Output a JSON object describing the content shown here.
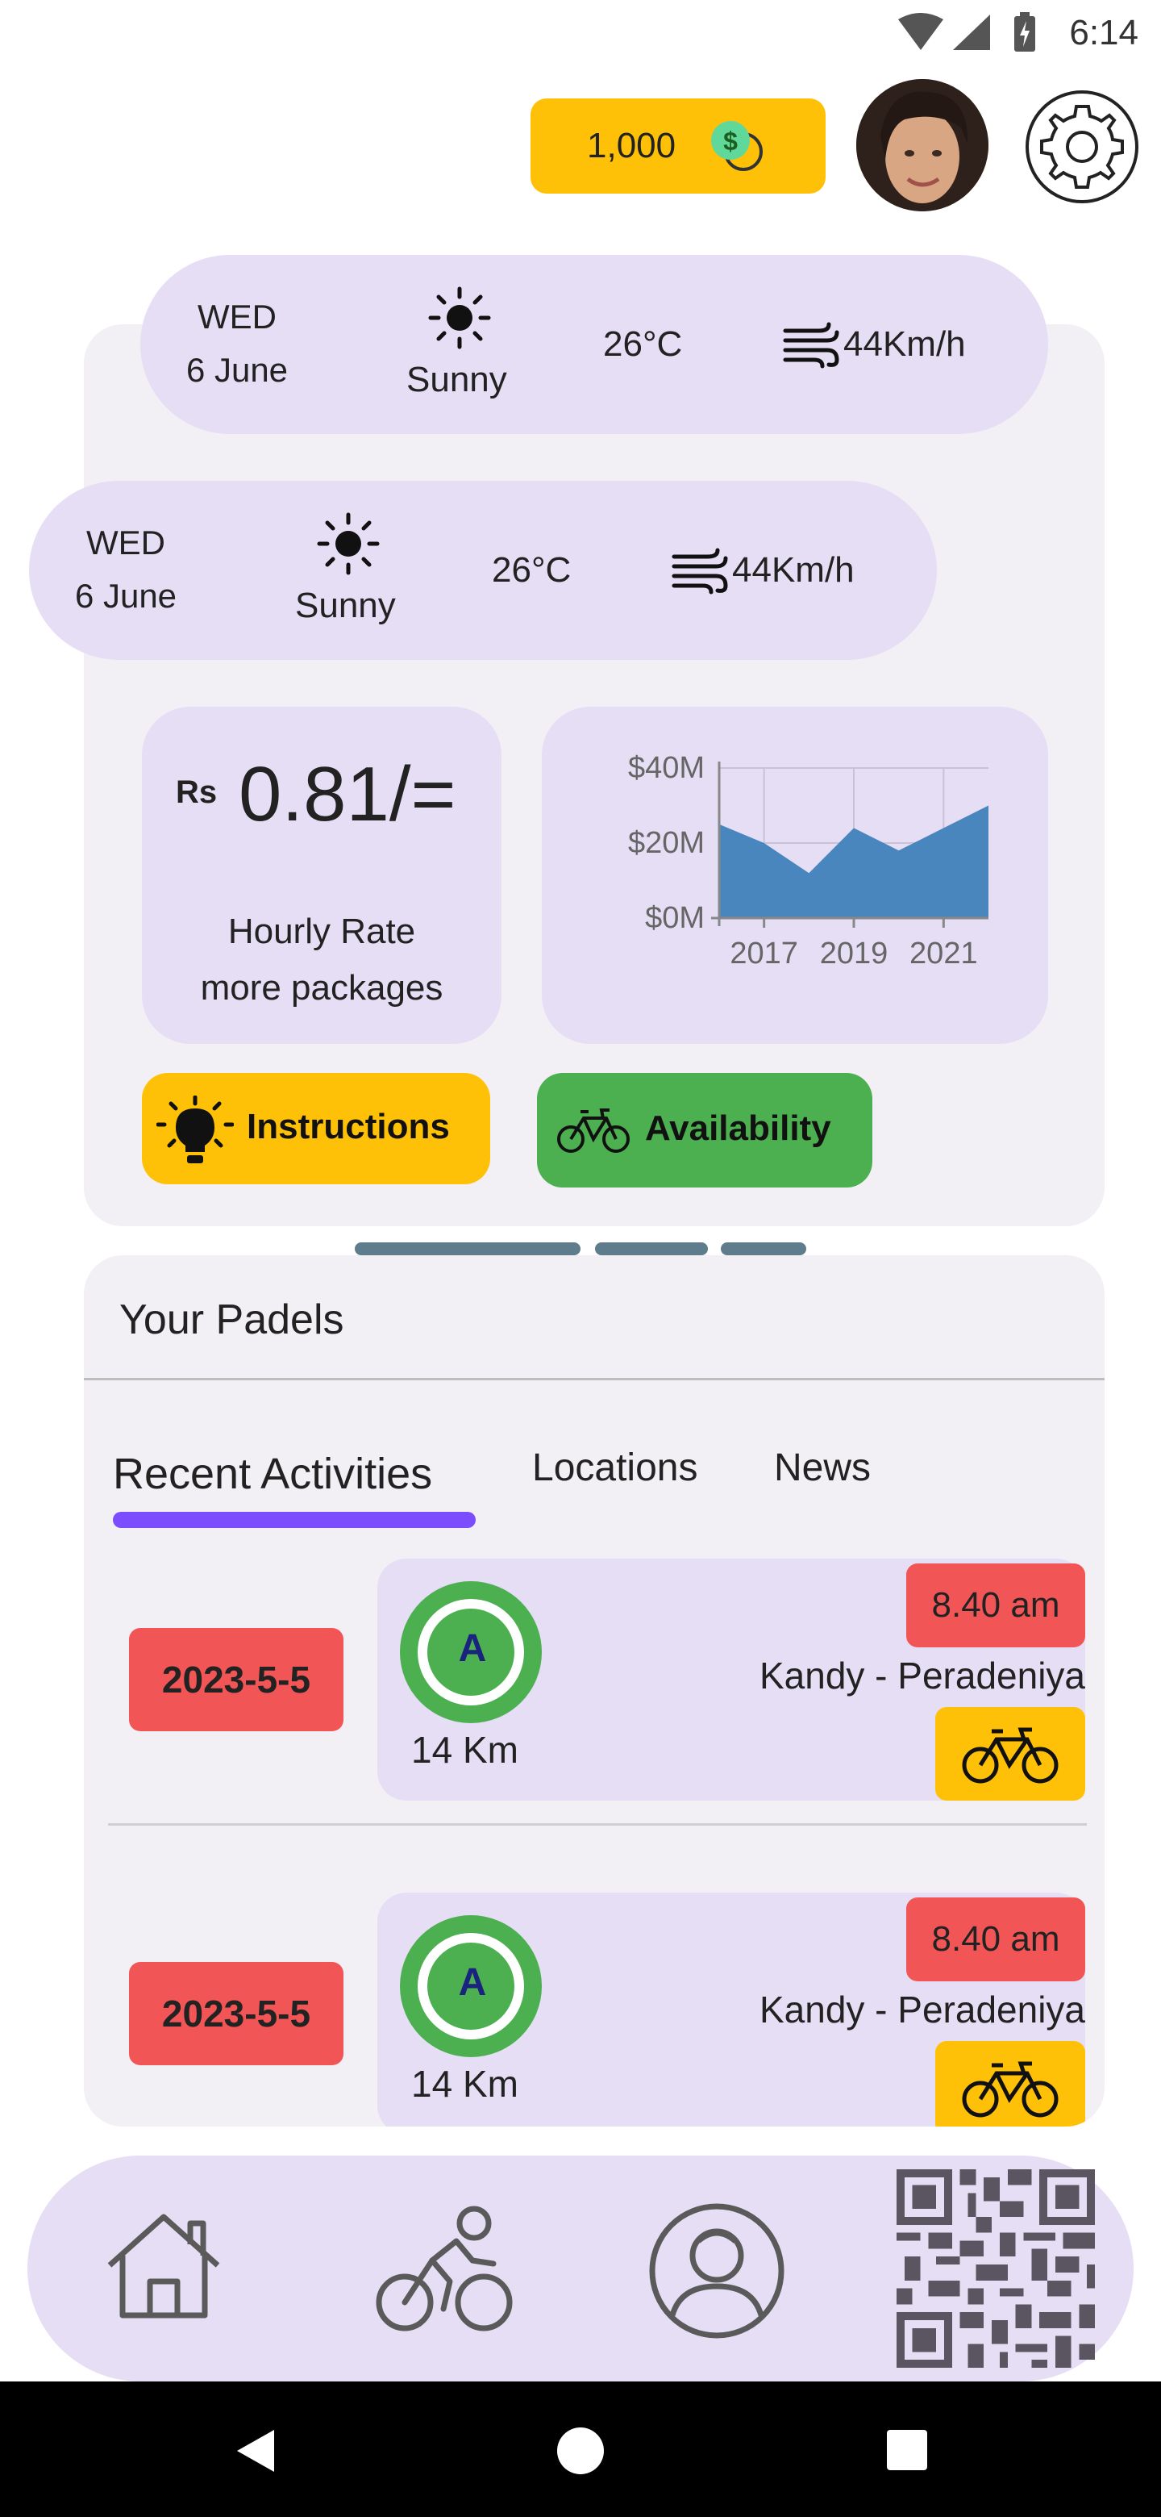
{
  "status_bar": {
    "time": "6:14"
  },
  "header": {
    "coins": "1,000"
  },
  "weather_cards": [
    {
      "day": "WED",
      "date": "6 June",
      "condition": "Sunny",
      "temperature": "26°C",
      "wind": "44Km/h"
    },
    {
      "day": "WED",
      "date": "6 June",
      "condition": "Sunny",
      "temperature": "26°C",
      "wind": "44Km/h"
    }
  ],
  "rate": {
    "currency": "Rs",
    "value": "0.81/=",
    "label_line1": "Hourly Rate",
    "label_line2": "more packages"
  },
  "chart_data": {
    "type": "area",
    "x": [
      2016,
      2017,
      2018,
      2019,
      2020,
      2021,
      2022
    ],
    "values": [
      25,
      20,
      12,
      24,
      18,
      24,
      30
    ],
    "y_tick_labels": [
      "$40M",
      "$20M",
      "$0M"
    ],
    "x_tick_labels": [
      "2017",
      "2019",
      "2021"
    ],
    "ylim": [
      0,
      40
    ],
    "color": "#4A86BE"
  },
  "buttons": {
    "instructions": "Instructions",
    "availability": "Availability"
  },
  "padels": {
    "title": "Your Padels",
    "tabs": [
      {
        "label": "Recent Activities",
        "active": true
      },
      {
        "label": "Locations",
        "active": false
      },
      {
        "label": "News",
        "active": false
      }
    ],
    "activities": [
      {
        "date": "2023-5-5",
        "marker": "A",
        "distance": "14 Km",
        "time": "8.40 am",
        "route": "Kandy - Peradeniya"
      },
      {
        "date": "2023-5-5",
        "marker": "A",
        "distance": "14 Km",
        "time": "8.40 am",
        "route": "Kandy - Peradeniya"
      }
    ]
  },
  "colors": {
    "accent": "#7C4DFF",
    "yellow": "#FFC107",
    "green": "#4CAF50",
    "red": "#F25555",
    "lavender": "#E6DEF5"
  }
}
